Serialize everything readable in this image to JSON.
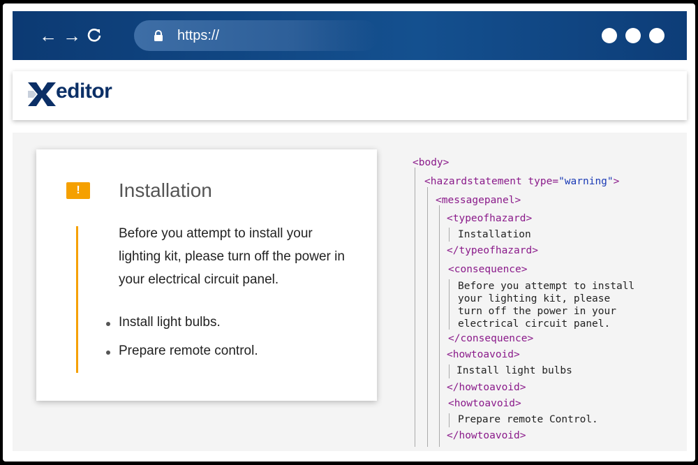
{
  "browser": {
    "url": "https://",
    "nav_icons": [
      "back-arrow-icon",
      "forward-arrow-icon",
      "reload-icon"
    ],
    "menu_dots": 3
  },
  "app": {
    "logo_letter": "X",
    "logo_text": "editor",
    "brand_color": "#0b2f66"
  },
  "card": {
    "icon": "warning-icon",
    "icon_glyph": "!",
    "accent_color": "#f5a000",
    "title": "Installation",
    "consequence": "Before you attempt to install your lighting kit, please turn off the power in your electrical circuit panel.",
    "bullets": [
      "Install light bulbs.",
      "Prepare remote control."
    ]
  },
  "xml": {
    "body_open": "<body>",
    "hazard_open": "<hazardstatement",
    "hazard_attr": "type=",
    "hazard_value": "\"warning\"",
    "hazard_close_bracket": ">",
    "messagepanel_open": "<messagepanel>",
    "typeofhazard_open": "<typeofhazard>",
    "typeofhazard_text": "Installation",
    "typeofhazard_close": "</typeofhazard>",
    "consequence_open": "<consequence>",
    "consequence_lines": [
      "Before you attempt to install",
      "your lighting kit, please",
      "turn off the power in your",
      "electrical circuit panel."
    ],
    "consequence_close": "</consequence>",
    "howtoavoid1_open": "<howtoavoid>",
    "howtoavoid1_text": "Install light bulbs",
    "howtoavoid1_close": "</howtoavoid>",
    "howtoavoid2_open": "<howtoavoid>",
    "howtoavoid2_text": "Prepare remote Control.",
    "howtoavoid2_close": "</howtoavoid>"
  }
}
